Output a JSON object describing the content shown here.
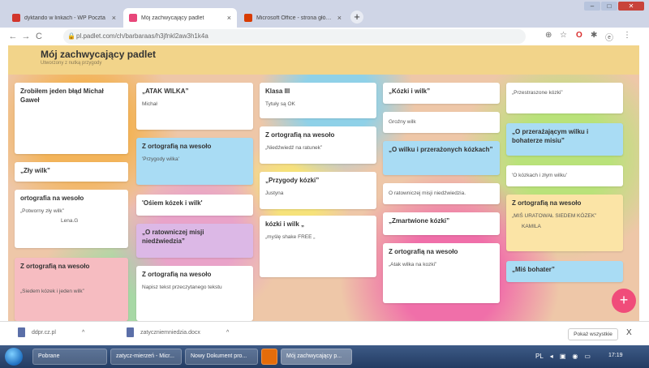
{
  "browser": {
    "tabs": [
      {
        "label": "dyktando w linkach - WP Poczta",
        "color": "#d2352c",
        "active": false
      },
      {
        "label": "Mój zachwycający padlet",
        "color": "#e8477a",
        "active": true
      },
      {
        "label": "Microsoft Office - strona główna",
        "color": "#d83b01",
        "active": false
      }
    ],
    "new_tab": "+",
    "close_tab": "×",
    "window_buttons": {
      "minimize": "–",
      "maximize": "□",
      "close": "✕"
    },
    "url": "pl.padlet.com/ch/barbaraas/h3jfnkl2aw3h1k4a",
    "lock_icon": "🔒",
    "nav": {
      "back": "←",
      "forward": "→",
      "reload": "C"
    },
    "extensions": {
      "icon1": "⊕",
      "icon2": "☆",
      "icon3": "O",
      "icon4": "✱",
      "profile": "ⓔ",
      "menu": "⋮"
    }
  },
  "padlet": {
    "title": "Mój zachwycający padlet",
    "subtitle": "Utworzony z nutką przygody",
    "add_button": "+",
    "columns": [
      {
        "cards": [
          {
            "title": "Zrobiłem jeden błąd Michał Gaweł",
            "body": "",
            "color": "white"
          },
          {
            "title": "„Zły wilk”",
            "body": "",
            "color": "white"
          },
          {
            "title": "ortografia na wesoło",
            "body": "„Potworny zły wilk”",
            "body2": "Lena.G",
            "color": "white"
          },
          {
            "title": "Z ortografią na wesoło",
            "body": "„Siedem kózek i jeden wilk”",
            "color": "pink"
          }
        ]
      },
      {
        "cards": [
          {
            "title": "„ATAK WILKA”",
            "body": "Michał",
            "color": "white"
          },
          {
            "title": "Z ortografią na wesoło",
            "body": "'Przygody wilka'",
            "color": "blue"
          },
          {
            "title": "'Ośiem kózek i wilk'",
            "body": "",
            "color": "white"
          },
          {
            "title": "„O ratowniczej misji niedźwiedzia”",
            "body": "",
            "color": "purple"
          },
          {
            "title": "Z ortografią na wesoło",
            "body": "Napisz tekst przeczytanego tekstu",
            "color": "white"
          }
        ]
      },
      {
        "cards": [
          {
            "title": "Klasa III",
            "body": "Tytuły są OK",
            "color": "white"
          },
          {
            "title": "Z ortografią na wesoło",
            "body": "„Niedźwiedź na ratunek”",
            "color": "white"
          },
          {
            "title": "„Przygody kózki”",
            "body": "Justyna",
            "color": "white"
          },
          {
            "title": "kózki i wilk „",
            "body": "„myślę shake FREE „",
            "color": "white"
          }
        ]
      },
      {
        "cards": [
          {
            "title": "„Kózki i wilk”",
            "body": "",
            "color": "white"
          },
          {
            "title": "",
            "body": "Groźny wilk",
            "color": "white"
          },
          {
            "title": "„O wilku i przerażonych kózkach”",
            "body": "",
            "color": "blue"
          },
          {
            "title": "",
            "body": "O ratowniczej misji niedźwiedzia.",
            "color": "white"
          },
          {
            "title": "„Zmartwione kózki”",
            "body": "",
            "color": "white"
          },
          {
            "title": "Z ortografią na wesoło",
            "body": "„Atak wilka na kozki”",
            "color": "white"
          }
        ]
      },
      {
        "cards": [
          {
            "title": "",
            "body": "„Przestraszone kózki”",
            "color": "white"
          },
          {
            "title": "„O przerażającym wilku i bohaterze misiu”",
            "body": "",
            "color": "blue"
          },
          {
            "title": "",
            "body": "'O kózkach i złym wilku'",
            "color": "white"
          },
          {
            "title": "Z ortografią na wesoło",
            "body": "„MIŚ URATOWAŁ SIEDEM KÓZEK”",
            "body2": "KAMILA",
            "color": "yellow"
          },
          {
            "title": "„Miś bohater”",
            "body": "",
            "color": "blue"
          }
        ]
      }
    ]
  },
  "downloads": {
    "items": [
      {
        "name": "ddpr.cz.pl",
        "chevron": "^"
      },
      {
        "name": "zatyczniemniedzia.docx",
        "chevron": "^"
      }
    ],
    "show_all": "Pokaż wszystkie",
    "close": "X"
  },
  "taskbar": {
    "items": [
      {
        "label": "Pobrane",
        "active": false
      },
      {
        "label": "zatycz-mierzeń - Micr...",
        "active": false
      },
      {
        "label": "Nowy Dokument pro...",
        "active": false
      },
      {
        "label": "",
        "active": false
      },
      {
        "label": "Mój zachwycający p...",
        "active": true
      }
    ],
    "tray": {
      "lang": "PL",
      "icon1": "◂",
      "icon2": "▣",
      "icon3": "◉",
      "icon4": "▭"
    },
    "time": "17:19"
  }
}
